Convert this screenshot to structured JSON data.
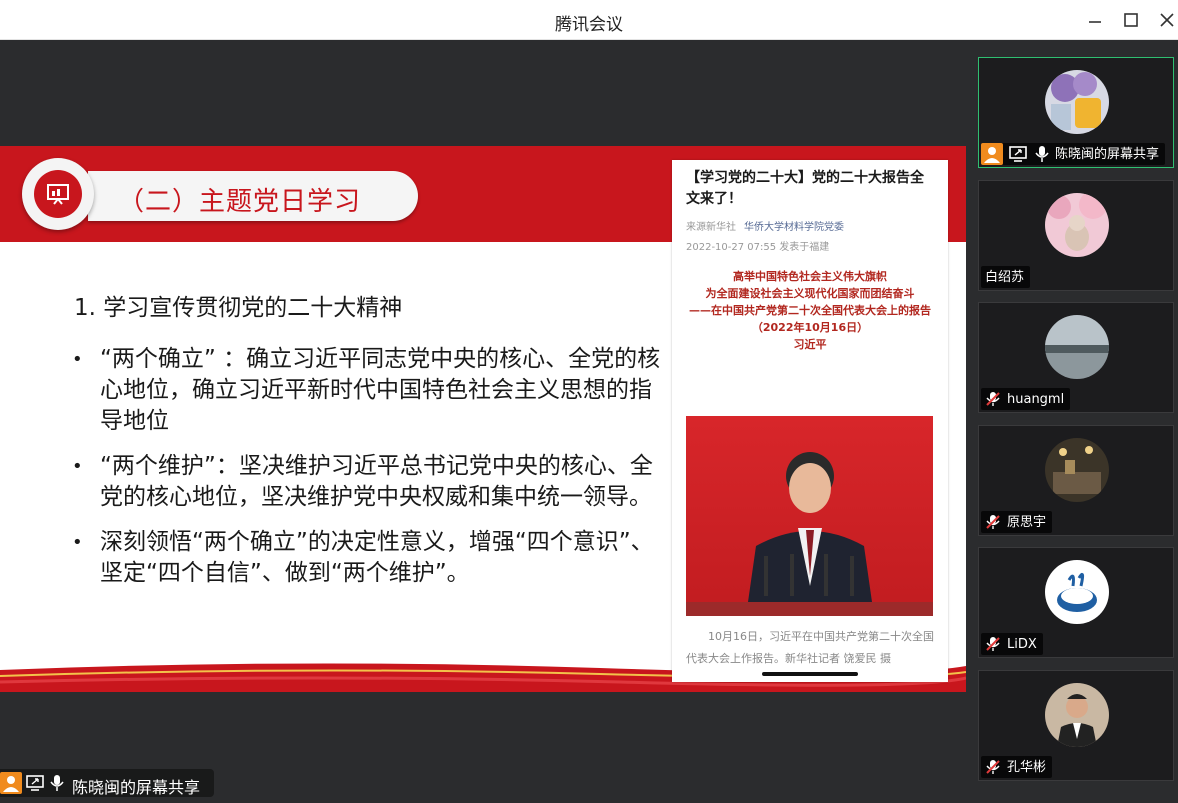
{
  "window": {
    "title": "腾讯会议"
  },
  "slide": {
    "section_title": "（二）主题党日学习",
    "heading": "1. 学习宣传贯彻党的二十大精神",
    "bullets": [
      "“两个确立” ：确立习近平同志党中央的核心、全党的核心地位，确立习近平新时代中国特色社会主义思想的指导地位",
      "“两个维护”：坚决维护习近平总书记党中央的核心、全党的核心地位，坚决维护党中央权威和集中统一领导。",
      "深刻领悟“两个确立”的决定性意义，增强“四个意识”、坚定“四个自信”、做到“两个维护”。"
    ],
    "article": {
      "title": "【学习党的二十大】党的二十大报告全文来了！",
      "source_prefix": "来源新华社",
      "source_account": "华侨大学材料学院党委",
      "date": "2022-10-27 07:55 发表于福建",
      "body_lines": [
        "高举中国特色社会主义伟大旗帜",
        "为全面建设社会主义现代化国家而团结奋斗",
        "——在中国共产党第二十次全国代表大会上的报告",
        "（2022年10月16日）",
        "习近平"
      ],
      "caption": "10月16日，习近平在中国共产党第二十次全国代表大会上作报告。新华社记者 饶爱民 摄"
    }
  },
  "share_label": "陈晓闽的屏幕共享",
  "participants": [
    {
      "name": "陈晓闽的屏幕共享",
      "muted": false,
      "active": true,
      "avatar": "flowers-cup-avatar"
    },
    {
      "name": "白绍苏",
      "muted": false,
      "active": false,
      "avatar": "cherry-blossom-avatar"
    },
    {
      "name": "huangml",
      "muted": true,
      "active": false,
      "avatar": "lake-avatar"
    },
    {
      "name": "原思宇",
      "muted": true,
      "active": false,
      "avatar": "cafe-avatar"
    },
    {
      "name": "LiDX",
      "muted": true,
      "active": false,
      "avatar": "coffee-cup-avatar"
    },
    {
      "name": "孔华彬",
      "muted": true,
      "active": false,
      "avatar": "portrait-avatar"
    }
  ],
  "colors": {
    "party_red": "#c8161d",
    "accent_green": "#2fbf71",
    "share_orange": "#f08b1e"
  }
}
